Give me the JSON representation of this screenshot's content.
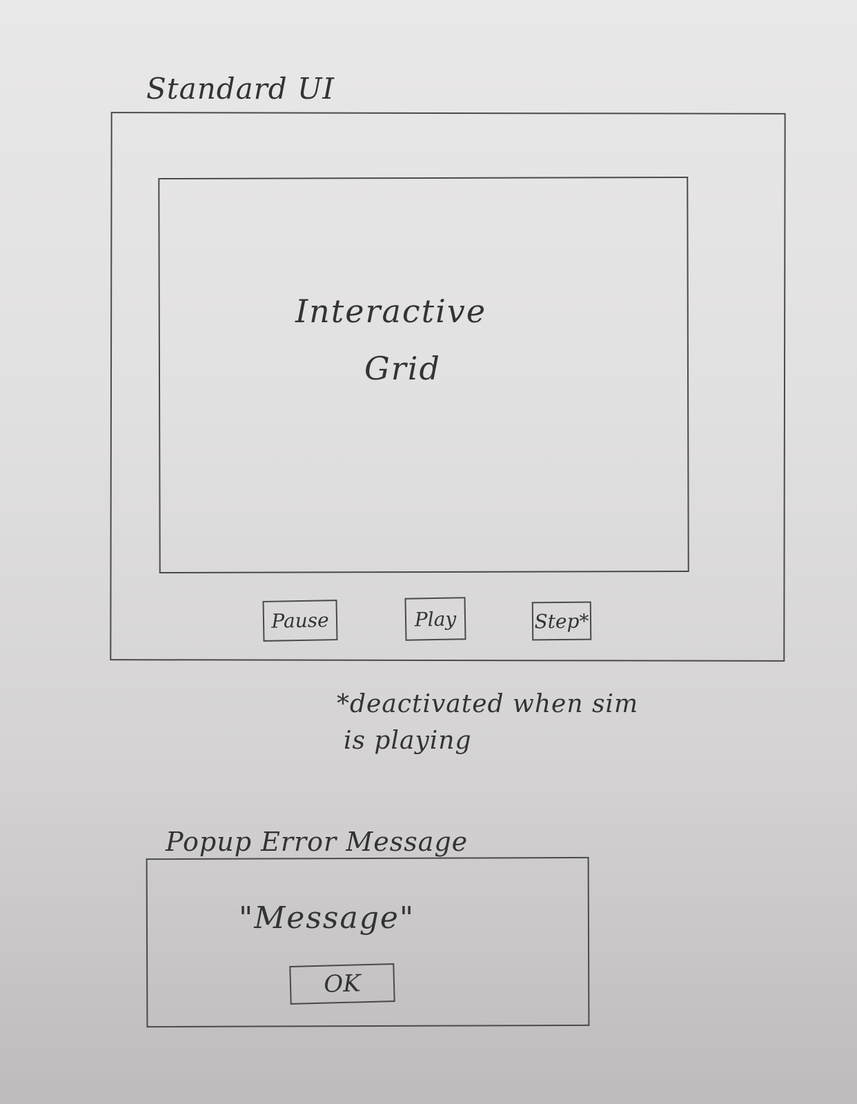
{
  "standard_ui": {
    "title": "Standard UI",
    "grid_label_line1": "Interactive",
    "grid_label_line2": "Grid",
    "buttons": {
      "pause": "Pause",
      "play": "Play",
      "step": "Step*"
    },
    "footnote_line1": "*deactivated when sim",
    "footnote_line2": "is playing"
  },
  "popup": {
    "title": "Popup Error Message",
    "message": "\"Message\"",
    "ok_label": "OK"
  }
}
